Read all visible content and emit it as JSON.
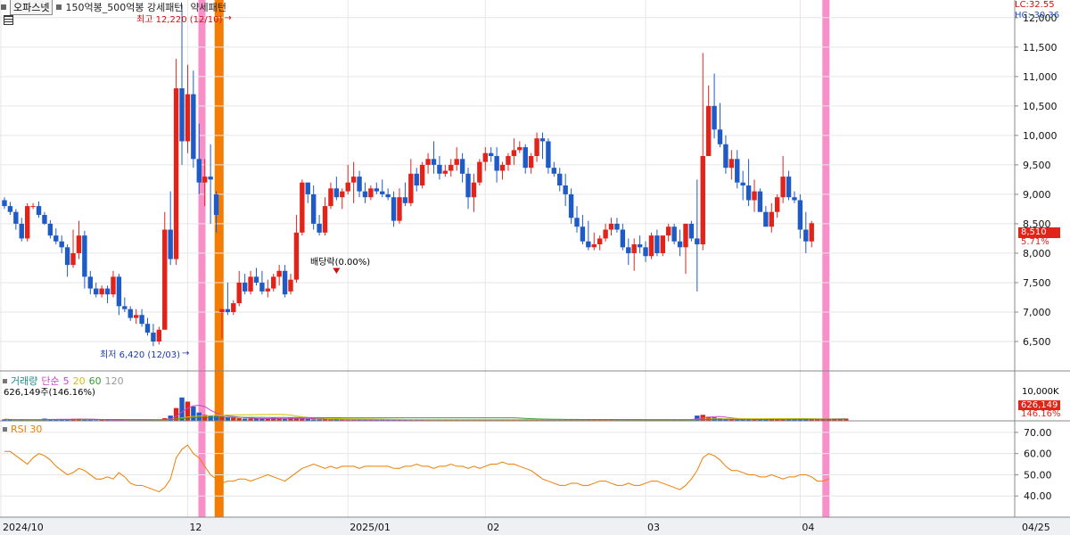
{
  "header": {
    "tab_label": "오파스넷",
    "condition_label": "150억봉_500억봉 강세패턴",
    "pattern_label": "약세패턴"
  },
  "indicators": {
    "lc": "LC:32.55",
    "hc": "HC:-30.36"
  },
  "annotations": {
    "high": "최고 12,220 (12/10)",
    "low": "최저 6,420 (12/03)",
    "dividend": "배당락(0.00%)"
  },
  "price_labels": {
    "last": "8,510",
    "change": "5.71%"
  },
  "volume_panel": {
    "title": "거래량",
    "ma_label": "단순",
    "ma_periods": [
      "5",
      "20",
      "60",
      "120"
    ],
    "ma_colors": [
      "#cc44cc",
      "#d4c000",
      "#2e9e2e",
      "#999999"
    ],
    "value_text": "626,149주(146.16%)",
    "axis_label": "10,000K",
    "last_value": "626,149",
    "last_pct": "146.16%"
  },
  "rsi_panel": {
    "title": "RSI 30"
  },
  "colors": {
    "up": "#e2231a",
    "down": "#1e5bc6",
    "pink_highlight": "#f78fc8",
    "orange_highlight": "#f47c00",
    "rsi_line": "#f07c00"
  },
  "chart_data": {
    "type": "candlestick",
    "price_axis": {
      "ylim": [
        6000,
        12300
      ],
      "ticks": [
        "6,500",
        "7,000",
        "7,500",
        "8,000",
        "8,500",
        "9,000",
        "9,500",
        "10,000",
        "10,500",
        "11,000",
        "11,500",
        "12,000"
      ],
      "tick_values": [
        6500,
        7000,
        7500,
        8000,
        8500,
        9000,
        9500,
        10000,
        10500,
        11000,
        11500,
        12000
      ]
    },
    "x_labels": [
      "2024/10",
      "12",
      "2025/01",
      "02",
      "03",
      "04",
      "04/25"
    ],
    "x_label_index": [
      0,
      32,
      60,
      84,
      112,
      139,
      170
    ],
    "highlights": [
      {
        "index": 34.5,
        "color": "pink"
      },
      {
        "index": 37.5,
        "color": "orange"
      },
      {
        "index": 143.5,
        "color": "pink"
      }
    ],
    "candles": [
      [
        8900,
        8950,
        8750,
        8800
      ],
      [
        8800,
        8870,
        8650,
        8700
      ],
      [
        8700,
        8750,
        8400,
        8500
      ],
      [
        8500,
        8600,
        8200,
        8250
      ],
      [
        8250,
        8850,
        8200,
        8800
      ],
      [
        8800,
        8850,
        8750,
        8800
      ],
      [
        8800,
        8880,
        8600,
        8650
      ],
      [
        8650,
        8700,
        8480,
        8500
      ],
      [
        8500,
        8560,
        8250,
        8300
      ],
      [
        8300,
        8420,
        8150,
        8200
      ],
      [
        8200,
        8300,
        8000,
        8100
      ],
      [
        8100,
        8150,
        7600,
        7800
      ],
      [
        7800,
        8400,
        7750,
        8000
      ],
      [
        8000,
        8550,
        7900,
        8300
      ],
      [
        8300,
        8380,
        7400,
        7600
      ],
      [
        7600,
        7700,
        7300,
        7400
      ],
      [
        7400,
        7500,
        7250,
        7300
      ],
      [
        7300,
        7450,
        7250,
        7400
      ],
      [
        7400,
        7450,
        7150,
        7300
      ],
      [
        7300,
        7700,
        7250,
        7600
      ],
      [
        7600,
        7650,
        6950,
        7100
      ],
      [
        7100,
        7250,
        7000,
        7050
      ],
      [
        7050,
        7100,
        6850,
        6900
      ],
      [
        6900,
        7050,
        6800,
        6950
      ],
      [
        6950,
        7050,
        6750,
        6800
      ],
      [
        6800,
        6900,
        6600,
        6650
      ],
      [
        6650,
        6800,
        6420,
        6500
      ],
      [
        6500,
        6750,
        6450,
        6700
      ],
      [
        6700,
        8700,
        7250,
        8400
      ],
      [
        8400,
        9050,
        7800,
        7900
      ],
      [
        7900,
        11300,
        7800,
        10800
      ],
      [
        10800,
        12220,
        9500,
        9900
      ],
      [
        9900,
        11200,
        9700,
        10700
      ],
      [
        10700,
        11100,
        9450,
        9600
      ],
      [
        9600,
        10200,
        9000,
        9200
      ],
      [
        9200,
        9600,
        8800,
        9300
      ],
      [
        9300,
        9850,
        8500,
        9250
      ],
      [
        9000,
        9050,
        8350,
        8650
      ],
      [
        7000,
        7050,
        6550,
        7050
      ],
      [
        7050,
        7500,
        6950,
        7000
      ],
      [
        7000,
        7200,
        6950,
        7150
      ],
      [
        7150,
        7700,
        7100,
        7500
      ],
      [
        7500,
        7650,
        7300,
        7350
      ],
      [
        7350,
        7700,
        7300,
        7600
      ],
      [
        7600,
        7750,
        7450,
        7500
      ],
      [
        7500,
        7700,
        7300,
        7350
      ],
      [
        7350,
        7550,
        7250,
        7400
      ],
      [
        7400,
        7650,
        7350,
        7600
      ],
      [
        7600,
        7800,
        7450,
        7700
      ],
      [
        7700,
        7800,
        7250,
        7300
      ],
      [
        7350,
        7650,
        7300,
        7550
      ],
      [
        7550,
        8650,
        7500,
        8350
      ],
      [
        8350,
        9250,
        8300,
        9200
      ],
      [
        9200,
        9200,
        8850,
        9000
      ],
      [
        9000,
        9150,
        8400,
        8500
      ],
      [
        8500,
        8650,
        8300,
        8350
      ],
      [
        8350,
        8950,
        8300,
        8800
      ],
      [
        8800,
        9200,
        8750,
        9100
      ],
      [
        9100,
        9300,
        8900,
        8950
      ],
      [
        8950,
        9100,
        8750,
        9050
      ],
      [
        9050,
        9500,
        9000,
        9200
      ],
      [
        9200,
        9550,
        8850,
        9300
      ],
      [
        9300,
        9400,
        8950,
        9050
      ],
      [
        9050,
        9200,
        8850,
        8950
      ],
      [
        8950,
        9150,
        8900,
        9100
      ],
      [
        9100,
        9200,
        9000,
        9050
      ],
      [
        9050,
        9250,
        8950,
        9000
      ],
      [
        9000,
        9100,
        8900,
        8950
      ],
      [
        8950,
        9050,
        8450,
        8550
      ],
      [
        8550,
        9100,
        8500,
        8950
      ],
      [
        8950,
        9200,
        8800,
        8850
      ],
      [
        8850,
        9600,
        8800,
        9350
      ],
      [
        9350,
        9450,
        9050,
        9150
      ],
      [
        9150,
        9550,
        9100,
        9500
      ],
      [
        9500,
        9700,
        9350,
        9600
      ],
      [
        9600,
        9900,
        9350,
        9500
      ],
      [
        9500,
        9650,
        9250,
        9350
      ],
      [
        9350,
        9500,
        9300,
        9400
      ],
      [
        9400,
        9600,
        9300,
        9500
      ],
      [
        9500,
        9800,
        9400,
        9600
      ],
      [
        9600,
        9700,
        9200,
        9350
      ],
      [
        9350,
        9450,
        8750,
        8950
      ],
      [
        8950,
        9350,
        8700,
        9200
      ],
      [
        9200,
        9600,
        9150,
        9550
      ],
      [
        9550,
        9800,
        9400,
        9700
      ],
      [
        9700,
        9800,
        9550,
        9650
      ],
      [
        9650,
        9800,
        9200,
        9400
      ],
      [
        9400,
        9550,
        9250,
        9500
      ],
      [
        9500,
        9700,
        9400,
        9650
      ],
      [
        9650,
        9950,
        9500,
        9750
      ],
      [
        9750,
        9900,
        9700,
        9800
      ],
      [
        9800,
        9850,
        9350,
        9450
      ],
      [
        9450,
        9700,
        9350,
        9650
      ],
      [
        9650,
        10050,
        9550,
        9950
      ],
      [
        9950,
        10050,
        9600,
        9900
      ],
      [
        9900,
        9950,
        9350,
        9450
      ],
      [
        9450,
        9550,
        9300,
        9350
      ],
      [
        9350,
        9450,
        9050,
        9150
      ],
      [
        9150,
        9350,
        8800,
        9000
      ],
      [
        9000,
        9100,
        8500,
        8600
      ],
      [
        8600,
        8800,
        8350,
        8450
      ],
      [
        8450,
        8650,
        8150,
        8200
      ],
      [
        8200,
        8550,
        8050,
        8100
      ],
      [
        8100,
        8350,
        8050,
        8150
      ],
      [
        8150,
        8300,
        8050,
        8250
      ],
      [
        8250,
        8500,
        8200,
        8400
      ],
      [
        8400,
        8600,
        8300,
        8500
      ],
      [
        8500,
        8600,
        8350,
        8400
      ],
      [
        8400,
        8500,
        8050,
        8100
      ],
      [
        8100,
        8250,
        7800,
        8000
      ],
      [
        8000,
        8250,
        7700,
        8150
      ],
      [
        8150,
        8300,
        8000,
        8100
      ],
      [
        8100,
        8200,
        7850,
        7950
      ],
      [
        7950,
        8350,
        7900,
        8300
      ],
      [
        8300,
        8400,
        7950,
        8000
      ],
      [
        8000,
        8300,
        7950,
        8300
      ],
      [
        8300,
        8500,
        8200,
        8450
      ],
      [
        8450,
        8500,
        8150,
        8200
      ],
      [
        8200,
        8400,
        7950,
        8100
      ],
      [
        8100,
        8500,
        7650,
        8500
      ],
      [
        8500,
        8550,
        8200,
        8250
      ],
      [
        8250,
        9250,
        7350,
        8150
      ],
      [
        8150,
        11400,
        8050,
        9650
      ],
      [
        9650,
        10850,
        9700,
        10500
      ],
      [
        10500,
        11050,
        9950,
        10100
      ],
      [
        10100,
        10550,
        9800,
        9850
      ],
      [
        9850,
        10000,
        9350,
        9450
      ],
      [
        9450,
        9750,
        9250,
        9600
      ],
      [
        9600,
        9750,
        9100,
        9200
      ],
      [
        9200,
        9400,
        8900,
        9150
      ],
      [
        9150,
        9600,
        8800,
        8900
      ],
      [
        8900,
        9250,
        8700,
        9050
      ],
      [
        9050,
        9100,
        8750,
        8700
      ],
      [
        8700,
        8800,
        8450,
        8450
      ],
      [
        8450,
        8850,
        8350,
        8700
      ],
      [
        8700,
        9000,
        8600,
        8950
      ],
      [
        8950,
        9650,
        8850,
        9300
      ],
      [
        9300,
        9400,
        8900,
        8950
      ],
      [
        8950,
        9050,
        8850,
        8900
      ],
      [
        8900,
        9000,
        8250,
        8400
      ],
      [
        8400,
        8700,
        8000,
        8200
      ],
      [
        8200,
        8550,
        8100,
        8510
      ]
    ],
    "rsi": {
      "ylim": [
        30,
        75
      ],
      "ticks": [
        40,
        50,
        60,
        70
      ],
      "tick_labels": [
        "40.00",
        "50.00",
        "60.00",
        "70.00"
      ],
      "values": [
        61,
        61,
        59,
        57,
        55,
        58,
        60,
        59,
        57,
        54,
        52,
        50,
        51,
        53,
        52,
        50,
        48,
        48,
        49,
        48,
        51,
        49,
        46,
        45,
        45,
        44,
        43,
        42,
        44,
        48,
        58,
        62,
        64,
        60,
        58,
        54,
        50,
        48,
        46,
        47,
        47,
        48,
        48,
        47,
        48,
        49,
        50,
        49,
        48,
        47,
        49,
        51,
        53,
        54,
        55,
        54,
        53,
        54,
        53,
        54,
        54,
        54,
        53,
        54,
        54,
        54,
        54,
        54,
        53,
        53,
        54,
        54,
        55,
        54,
        54,
        53,
        54,
        54,
        55,
        54,
        54,
        53,
        54,
        53,
        54,
        55,
        55,
        56,
        55,
        55,
        54,
        53,
        52,
        50,
        48,
        47,
        46,
        45,
        45,
        46,
        46,
        45,
        45,
        46,
        47,
        47,
        46,
        45,
        45,
        46,
        45,
        45,
        46,
        47,
        47,
        46,
        45,
        44,
        43,
        45,
        48,
        52,
        58,
        60,
        59,
        57,
        54,
        52,
        52,
        51,
        50,
        50,
        49,
        49,
        50,
        49,
        48,
        49,
        49,
        50,
        50,
        49,
        47,
        47,
        48
      ]
    },
    "volume": {
      "values": [
        40,
        30,
        20,
        35,
        30,
        25,
        30,
        60,
        45,
        30,
        40,
        35,
        55,
        60,
        40,
        30,
        20,
        25,
        30,
        20,
        25,
        15,
        20,
        15,
        20,
        15,
        20,
        15,
        70,
        140,
        340,
        620,
        510,
        380,
        220,
        160,
        140,
        130,
        120,
        100,
        80,
        70,
        60,
        60,
        60,
        60,
        55,
        80,
        60,
        50,
        80,
        70,
        60,
        50,
        40,
        40,
        35,
        30,
        30,
        30,
        30,
        30,
        30,
        30,
        30,
        30,
        30,
        30,
        30,
        30,
        30,
        30,
        30,
        30,
        30,
        30,
        30,
        30,
        30,
        30,
        30,
        30,
        30,
        30,
        30,
        30,
        30,
        30,
        30,
        30,
        30,
        30,
        30,
        30,
        30,
        30,
        30,
        30,
        30,
        30,
        30,
        30,
        30,
        30,
        30,
        30,
        30,
        30,
        30,
        30,
        30,
        30,
        30,
        30,
        30,
        30,
        30,
        30,
        30,
        30,
        40,
        140,
        160,
        110,
        90,
        70,
        60,
        50,
        45,
        40,
        40,
        40,
        40,
        40,
        40,
        40,
        40,
        45,
        45,
        50,
        50,
        50,
        50,
        50,
        50,
        60,
        55,
        60
      ]
    }
  }
}
